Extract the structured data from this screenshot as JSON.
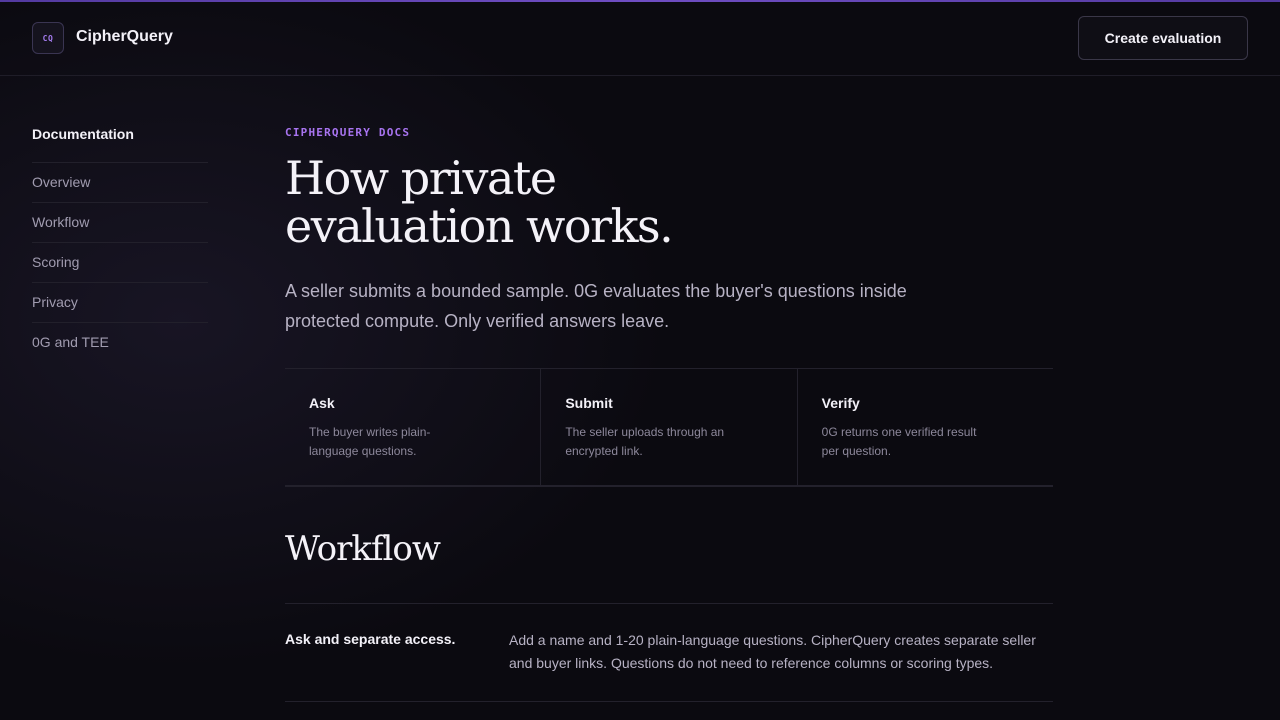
{
  "header": {
    "logo_text": "CQ",
    "brand": "CipherQuery",
    "create_button": "Create evaluation"
  },
  "sidebar": {
    "title": "Documentation",
    "items": [
      {
        "label": "Overview"
      },
      {
        "label": "Workflow"
      },
      {
        "label": "Scoring"
      },
      {
        "label": "Privacy"
      },
      {
        "label": "0G and TEE"
      }
    ]
  },
  "main": {
    "eyebrow": "CIPHERQUERY DOCS",
    "title": "How private evaluation works.",
    "lead": "A seller submits a bounded sample. 0G evaluates the buyer's questions inside protected compute. Only verified answers leave.",
    "cards": [
      {
        "title": "Ask",
        "desc": "The buyer writes plain-language questions."
      },
      {
        "title": "Submit",
        "desc": "The seller uploads through an encrypted link."
      },
      {
        "title": "Verify",
        "desc": "0G returns one verified result per question."
      }
    ],
    "section_title": "Workflow",
    "steps": [
      {
        "title": "Ask and separate access.",
        "desc": "Add a name and 1-20 plain-language questions. CipherQuery creates separate seller and buyer links. Questions do not need to reference columns or scoring types."
      }
    ]
  },
  "colors": {
    "accent": "#a874f0",
    "background": "#0b0a10"
  }
}
